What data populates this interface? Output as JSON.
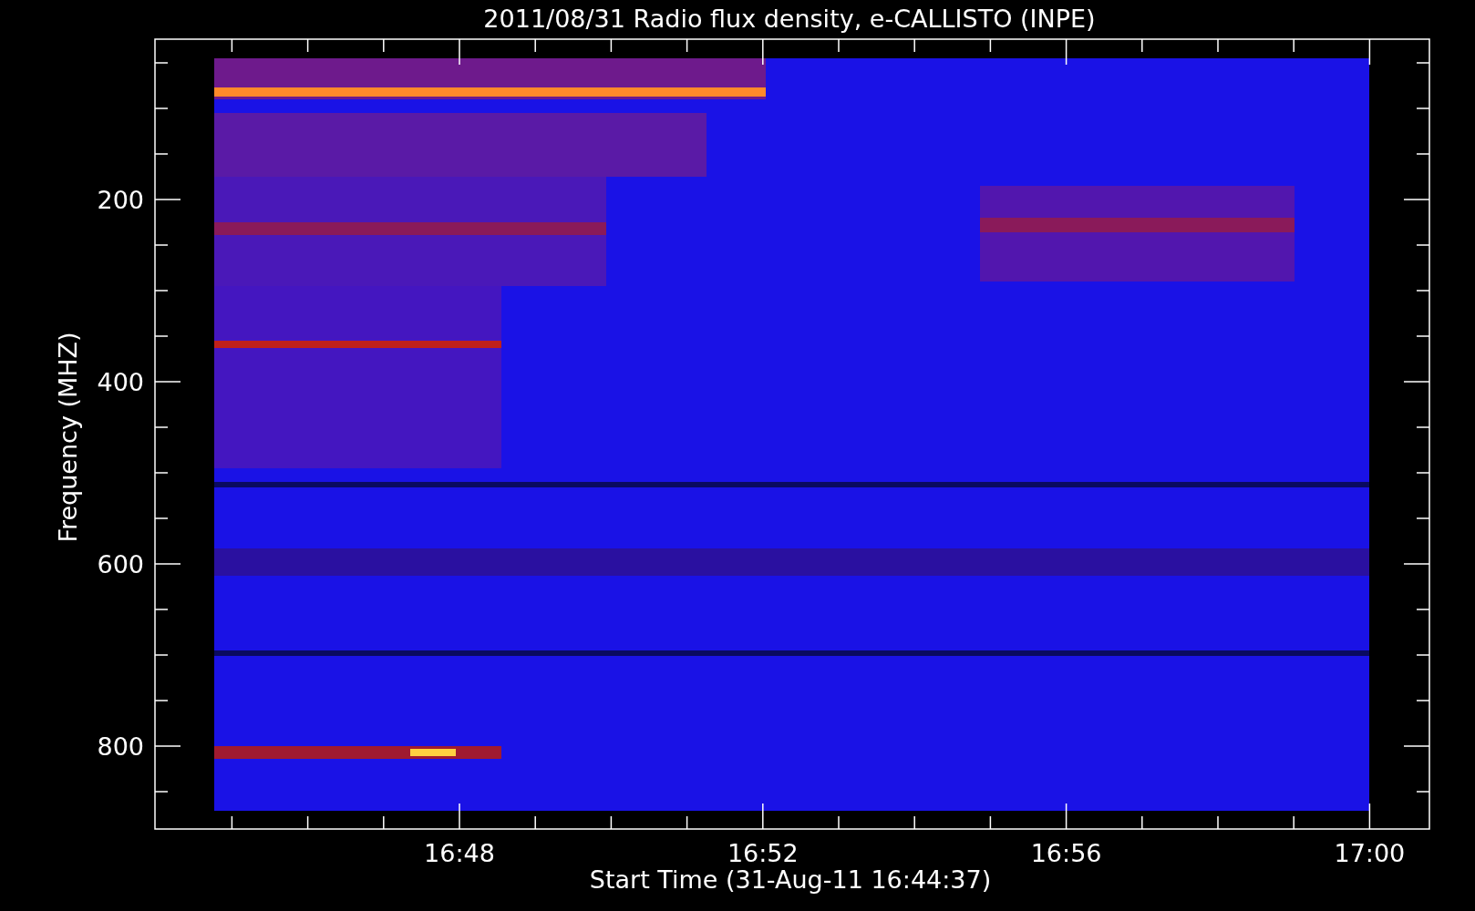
{
  "title": "2011/08/31  Radio flux density, e-CALLISTO (INPE)",
  "plot": {
    "kind": "picture",
    "ylabel": "Frequency (MHZ)",
    "y_tick_labels": [
      "200",
      "400",
      "600",
      "800"
    ],
    "x_tick_labels": [
      "16:48",
      "16:52",
      "16:56",
      "17:00"
    ],
    "xlabel": "Start Time (31-Aug-11 16:44:37)"
  }
}
